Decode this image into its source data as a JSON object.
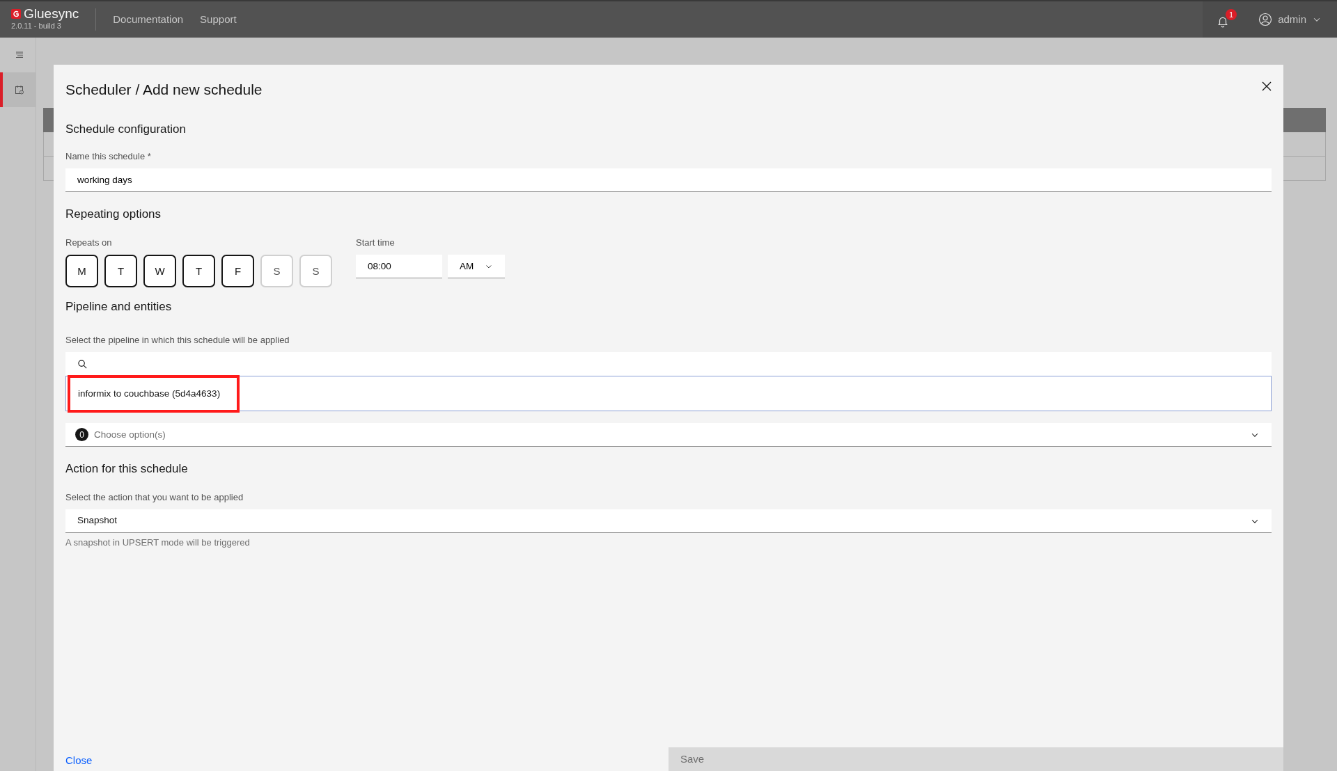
{
  "app": {
    "name": "Gluesync",
    "version": "2.0.11 - build 3",
    "nav": [
      "Documentation",
      "Support"
    ],
    "notifications": "1",
    "user": "admin"
  },
  "sidebar": {
    "items": [
      {
        "kind": "list",
        "selected": false
      },
      {
        "kind": "calendar",
        "selected": true
      }
    ]
  },
  "dialog": {
    "title": "Scheduler / Add new schedule",
    "config": {
      "heading": "Schedule configuration",
      "name_label": "Name this schedule *",
      "name_value": "working days"
    },
    "repeat": {
      "heading": "Repeating options",
      "days_label": "Repeats on",
      "days": [
        {
          "label": "M",
          "selected": true
        },
        {
          "label": "T",
          "selected": true
        },
        {
          "label": "W",
          "selected": true
        },
        {
          "label": "T",
          "selected": true
        },
        {
          "label": "F",
          "selected": true
        },
        {
          "label": "S",
          "selected": false
        },
        {
          "label": "S",
          "selected": false
        }
      ],
      "time_label": "Start time",
      "time_value": "08:00",
      "period": "AM"
    },
    "pipeline": {
      "heading": "Pipeline and entities",
      "label": "Select the pipeline in which this schedule will be applied",
      "options": [
        {
          "label": "informix to couchbase (5d4a4633)",
          "highlighted": true
        }
      ],
      "entities_count": "0",
      "entities_placeholder": "Choose option(s)"
    },
    "action": {
      "heading": "Action for this schedule",
      "label": "Select the action that you want to be applied",
      "value": "Snapshot",
      "helper": "A snapshot in UPSERT mode will be triggered"
    },
    "close": "Close",
    "save": {
      "label": "Save",
      "disabled": true
    }
  }
}
